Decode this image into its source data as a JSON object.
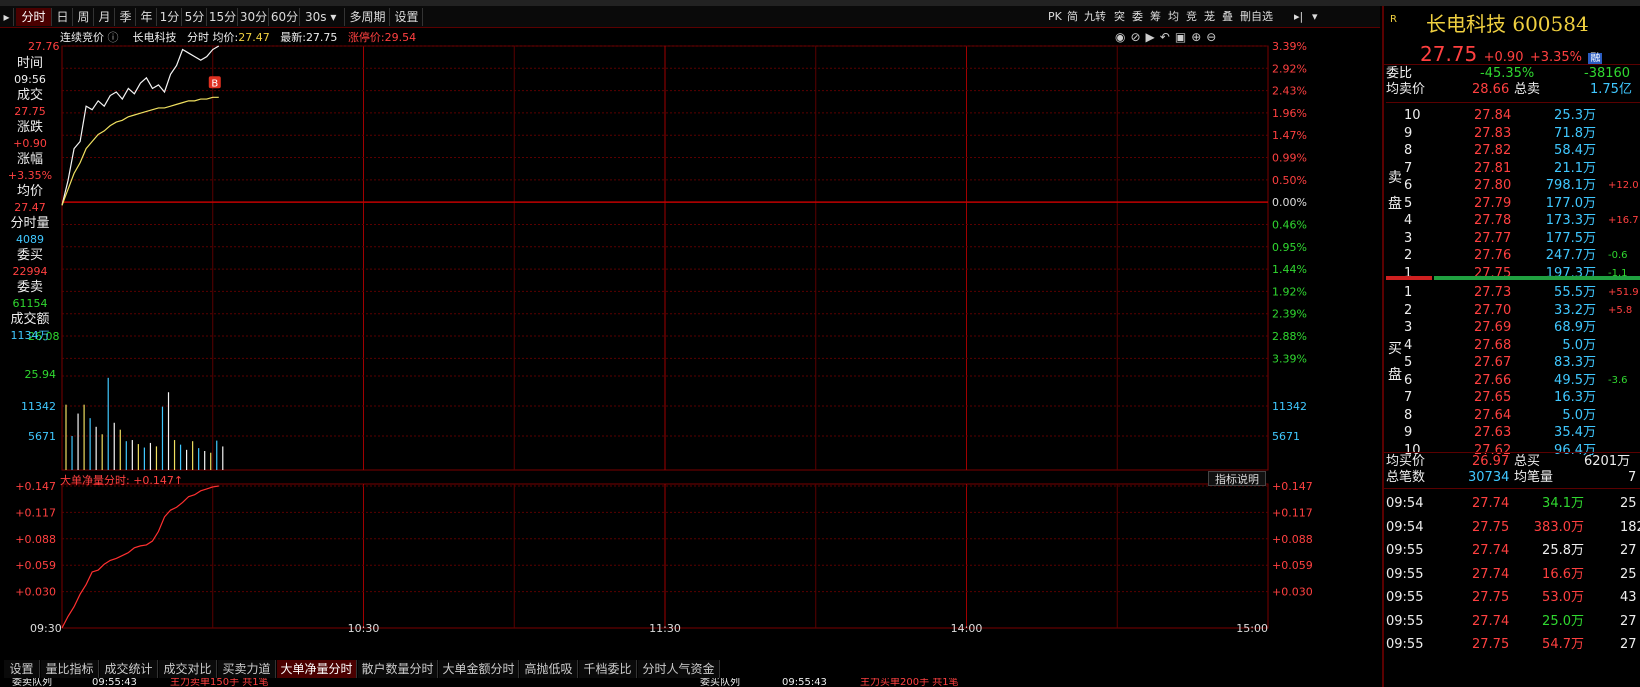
{
  "period_tabs": [
    "分时",
    "日",
    "周",
    "月",
    "季",
    "年",
    "1分",
    "5分",
    "15分",
    "30分",
    "60分",
    "30s",
    "多周期",
    "设置"
  ],
  "period_active": "分时",
  "right_tools": [
    "PK",
    "简",
    "九转",
    "突",
    "委",
    "筹",
    "均",
    "竞",
    "茏",
    "叠",
    "刪自选"
  ],
  "header": {
    "auction": "连续竞价",
    "stock_name": "长电科技",
    "mode": "分时",
    "avg_label": "均价:",
    "avg_value": "27.47",
    "latest_label": "最新:",
    "latest_value": "27.75",
    "limit_label": "涨停价:",
    "limit_value": "29.54"
  },
  "left_panel": [
    {
      "label": "时间",
      "value": "09:56"
    },
    {
      "label": "成交",
      "value": "27.75"
    },
    {
      "label": "涨跌",
      "value": "+0.90"
    },
    {
      "label": "涨幅",
      "value": "+3.35%"
    },
    {
      "label": "均价",
      "value": "27.47"
    },
    {
      "label": "分时量",
      "value": "4089"
    },
    {
      "label": "委买",
      "value": "22994"
    },
    {
      "label": "委卖",
      "value": "61154"
    },
    {
      "label": "成交额",
      "value": "1134万"
    }
  ],
  "price_axis": {
    "left_top": "27.76",
    "left_bottom": "26.08",
    "right_pct": [
      "3.39%",
      "2.92%",
      "2.43%",
      "1.96%",
      "1.47%",
      "0.99%",
      "0.50%",
      "0.00%",
      "0.46%",
      "0.95%",
      "1.44%",
      "1.92%",
      "2.39%",
      "2.88%",
      "3.39%"
    ]
  },
  "volume_axis": {
    "left": [
      "25.94",
      "11342",
      "5671"
    ],
    "right": [
      "11342",
      "5671"
    ]
  },
  "indicator": {
    "title": "大单净量分时:",
    "value": "+0.147↑",
    "help": "指标说明",
    "ticks": [
      "+0.147",
      "+0.117",
      "+0.088",
      "+0.059",
      "+0.030"
    ]
  },
  "time_axis": [
    "09:30",
    "10:30",
    "11:30",
    "14:00",
    "15:00"
  ],
  "bottom_tabs": [
    "设置",
    "量比指标",
    "成交统计",
    "成交对比",
    "买卖力道",
    "大单净量分时",
    "散户数量分时",
    "大单金额分时",
    "高抛低吸",
    "千档委比",
    "分时人气资金"
  ],
  "bottom_active": "大单净量分时",
  "status_bar": [
    "委卖队列",
    "09:55:43",
    "主力卖单150手 共1笔",
    "委买队列",
    "09:55:43",
    "主力买单200手 共1笔"
  ],
  "quote": {
    "flag": "R",
    "name": "长电科技",
    "code": "600584",
    "price": "27.75",
    "change": "+0.90",
    "pct": "+3.35%",
    "market": "融",
    "weibi_label": "委比",
    "weibi_value": "-45.35%",
    "weicha_value": "-38160",
    "avg_sell_label": "均卖价",
    "avg_sell_value": "28.66",
    "total_sell_label": "总卖",
    "total_sell_value": "1.75亿",
    "sell_side_label": "卖盘",
    "buy_side_label": "买盘",
    "sell_orders": [
      {
        "lvl": "10",
        "price": "27.84",
        "vol": "25.3万",
        "chg": ""
      },
      {
        "lvl": "9",
        "price": "27.83",
        "vol": "71.8万",
        "chg": ""
      },
      {
        "lvl": "8",
        "price": "27.82",
        "vol": "58.4万",
        "chg": ""
      },
      {
        "lvl": "7",
        "price": "27.81",
        "vol": "21.1万",
        "chg": ""
      },
      {
        "lvl": "6",
        "price": "27.80",
        "vol": "798.1万",
        "chg": "+12.0"
      },
      {
        "lvl": "5",
        "price": "27.79",
        "vol": "177.0万",
        "chg": ""
      },
      {
        "lvl": "4",
        "price": "27.78",
        "vol": "173.3万",
        "chg": "+16.7"
      },
      {
        "lvl": "3",
        "price": "27.77",
        "vol": "177.5万",
        "chg": ""
      },
      {
        "lvl": "2",
        "price": "27.76",
        "vol": "247.7万",
        "chg": "-0.6"
      },
      {
        "lvl": "1",
        "price": "27.75",
        "vol": "197.3万",
        "chg": "-1.1"
      }
    ],
    "buy_orders": [
      {
        "lvl": "1",
        "price": "27.73",
        "vol": "55.5万",
        "chg": "+51.9"
      },
      {
        "lvl": "2",
        "price": "27.70",
        "vol": "33.2万",
        "chg": "+5.8"
      },
      {
        "lvl": "3",
        "price": "27.69",
        "vol": "68.9万",
        "chg": ""
      },
      {
        "lvl": "4",
        "price": "27.68",
        "vol": "5.0万",
        "chg": ""
      },
      {
        "lvl": "5",
        "price": "27.67",
        "vol": "83.3万",
        "chg": ""
      },
      {
        "lvl": "6",
        "price": "27.66",
        "vol": "49.5万",
        "chg": "-3.6"
      },
      {
        "lvl": "7",
        "price": "27.65",
        "vol": "16.3万",
        "chg": ""
      },
      {
        "lvl": "8",
        "price": "27.64",
        "vol": "5.0万",
        "chg": ""
      },
      {
        "lvl": "9",
        "price": "27.63",
        "vol": "35.4万",
        "chg": ""
      },
      {
        "lvl": "10",
        "price": "27.62",
        "vol": "96.4万",
        "chg": ""
      }
    ],
    "avg_buy_label": "均买价",
    "avg_buy_value": "26.97",
    "total_buy_label": "总买",
    "total_buy_value": "6201万",
    "total_trades_label": "总笔数",
    "total_trades_value": "30734",
    "avg_trade_label": "均笔量",
    "avg_trade_value": "7",
    "ticks": [
      {
        "time": "09:54",
        "price": "27.74",
        "vol": "34.1万",
        "n": "25",
        "vc": "green"
      },
      {
        "time": "09:54",
        "price": "27.75",
        "vol": "383.0万",
        "n": "182",
        "vc": "red"
      },
      {
        "time": "09:55",
        "price": "27.74",
        "vol": "25.8万",
        "n": "27",
        "vc": "white"
      },
      {
        "time": "09:55",
        "price": "27.74",
        "vol": "16.6万",
        "n": "25",
        "vc": "red"
      },
      {
        "time": "09:55",
        "price": "27.75",
        "vol": "53.0万",
        "n": "43",
        "vc": "red"
      },
      {
        "time": "09:55",
        "price": "27.74",
        "vol": "25.0万",
        "n": "27",
        "vc": "green"
      },
      {
        "time": "09:55",
        "price": "27.75",
        "vol": "54.7万",
        "n": "27",
        "vc": "red"
      }
    ]
  },
  "chart_data": [
    {
      "type": "line",
      "title": "",
      "x": [
        "09:30",
        "09:31",
        "09:32",
        "09:33",
        "09:34",
        "09:35",
        "09:36",
        "09:37",
        "09:38",
        "09:39",
        "09:40",
        "09:41",
        "09:42",
        "09:43",
        "09:44",
        "09:45",
        "09:46",
        "09:47",
        "09:48",
        "09:49",
        "09:50",
        "09:51",
        "09:52",
        "09:53",
        "09:54",
        "09:55",
        "09:56"
      ],
      "series": [
        {
          "values": [
            26.86,
            27.0,
            27.18,
            27.22,
            27.42,
            27.4,
            27.45,
            27.42,
            27.48,
            27.5,
            27.46,
            27.52,
            27.49,
            27.55,
            27.58,
            27.52,
            27.54,
            27.5,
            27.6,
            27.65,
            27.74,
            27.72,
            27.7,
            27.68,
            27.7,
            27.74,
            27.76
          ]
        },
        {
          "values": [
            26.86,
            26.95,
            27.04,
            27.1,
            27.18,
            27.22,
            27.26,
            27.28,
            27.31,
            27.33,
            27.34,
            27.36,
            27.37,
            27.38,
            27.39,
            27.4,
            27.41,
            27.41,
            27.42,
            27.43,
            27.44,
            27.45,
            27.45,
            27.46,
            27.46,
            27.47,
            27.47
          ]
        }
      ],
      "ylim": [
        25.94,
        27.76
      ],
      "grid": true
    },
    {
      "type": "bar",
      "categories": [
        "09:30",
        "09:31",
        "09:32",
        "09:33",
        "09:34",
        "09:35",
        "09:36",
        "09:37",
        "09:38",
        "09:39",
        "09:40",
        "09:41",
        "09:42",
        "09:43",
        "09:44",
        "09:45",
        "09:46",
        "09:47",
        "09:48",
        "09:49",
        "09:50",
        "09:51",
        "09:52",
        "09:53",
        "09:54",
        "09:55",
        "09:56"
      ],
      "values": [
        11342,
        5900,
        9800,
        11342,
        9000,
        7500,
        6200,
        16000,
        8200,
        7000,
        5000,
        5200,
        4500,
        3900,
        4700,
        4100,
        11000,
        13500,
        5200,
        4400,
        3500,
        5000,
        3800,
        3300,
        3000,
        5100,
        4089
      ],
      "ylim": [
        0,
        17013
      ],
      "grid": true
    },
    {
      "type": "line",
      "title": "大单净量分时",
      "x": [
        "09:30",
        "09:31",
        "09:32",
        "09:33",
        "09:34",
        "09:35",
        "09:36",
        "09:37",
        "09:38",
        "09:39",
        "09:40",
        "09:41",
        "09:42",
        "09:43",
        "09:44",
        "09:45",
        "09:46",
        "09:47",
        "09:48",
        "09:49",
        "09:50",
        "09:51",
        "09:52",
        "09:53",
        "09:54",
        "09:55",
        "09:56"
      ],
      "series": [
        {
          "values": [
            0.0,
            0.012,
            0.022,
            0.035,
            0.045,
            0.058,
            0.06,
            0.066,
            0.07,
            0.072,
            0.075,
            0.078,
            0.083,
            0.085,
            0.086,
            0.09,
            0.1,
            0.115,
            0.122,
            0.125,
            0.13,
            0.136,
            0.138,
            0.142,
            0.144,
            0.146,
            0.147
          ]
        }
      ],
      "ylim": [
        0.0,
        0.147
      ],
      "grid": true
    }
  ]
}
